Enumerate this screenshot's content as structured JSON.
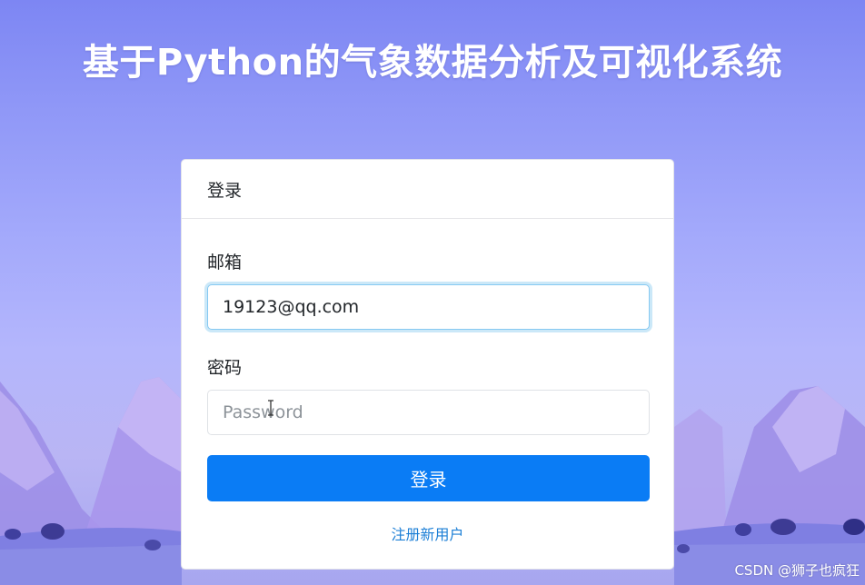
{
  "page": {
    "title": "基于Python的气象数据分析及可视化系统",
    "watermark": "CSDN @狮子也疯狂"
  },
  "login_card": {
    "header": "登录",
    "email_label": "邮箱",
    "email_value": "19123@qq.com",
    "password_label": "密码",
    "password_placeholder": "Password",
    "password_value": "",
    "submit_label": "登录",
    "register_link": "注册新用户"
  },
  "colors": {
    "primary_button": "#0a7cf5",
    "link": "#1c7fd6",
    "focus_ring": "#86c9f2",
    "background_top": "#7d86f3",
    "background_bottom": "#a7a6ef"
  },
  "icons": {
    "text_cursor": "i-beam-cursor-icon"
  }
}
